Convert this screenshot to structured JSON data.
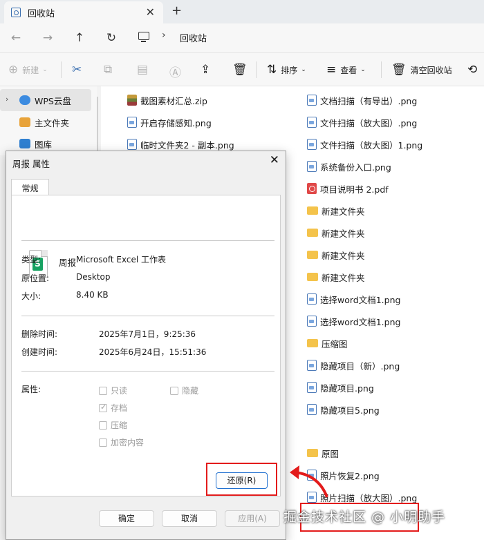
{
  "window": {
    "tab_title": "回收站",
    "tab_close_icon": "close-icon",
    "new_tab_icon": "plus-icon"
  },
  "nav": {
    "back": "←",
    "forward": "→",
    "up": "↑",
    "refresh": "↻",
    "breadcrumb_separator": "›",
    "breadcrumb": "回收站"
  },
  "toolbar": {
    "new_label": "新建",
    "sort_label": "排序",
    "view_label": "查看",
    "empty_bin_label": "清空回收站",
    "icons": [
      "cut-icon",
      "copy-icon",
      "paste-icon",
      "rename-icon",
      "share-icon",
      "delete-icon"
    ]
  },
  "sidebar": {
    "items": [
      {
        "label": "WPS云盘",
        "icon": "cloud-icon",
        "selected": true
      },
      {
        "label": "主文件夹",
        "icon": "home-icon"
      },
      {
        "label": "图库",
        "icon": "gallery-icon"
      }
    ]
  },
  "files": {
    "col1": [
      {
        "name": "截图素材汇总.zip",
        "type": "zip"
      },
      {
        "name": "开启存储感知.png",
        "type": "png"
      },
      {
        "name": "临时文件夹2 - 副本.png",
        "type": "png"
      }
    ],
    "col2": [
      {
        "name": "文档扫描（有导出）.png",
        "type": "png"
      },
      {
        "name": "文件扫描（放大图）.png",
        "type": "png"
      },
      {
        "name": "文件扫描（放大图）1.png",
        "type": "png"
      },
      {
        "name": "系统备份入口.png",
        "type": "png"
      },
      {
        "name": "项目说明书 2.pdf",
        "type": "pdf"
      },
      {
        "name": "新建文件夹",
        "type": "folder"
      },
      {
        "name": "新建文件夹",
        "type": "folder"
      },
      {
        "name": "新建文件夹",
        "type": "folder"
      },
      {
        "name": "新建文件夹",
        "type": "folder"
      },
      {
        "name": "选择word文档1.png",
        "type": "png"
      },
      {
        "name": "选择word文档1.png",
        "type": "png"
      },
      {
        "name": "压缩图",
        "type": "folder"
      },
      {
        "name": "隐藏项目（新）.png",
        "type": "png"
      },
      {
        "name": "隐藏项目.png",
        "type": "png"
      },
      {
        "name": "隐藏项目5.png",
        "type": "png"
      },
      {
        "name": "原图",
        "type": "folder"
      },
      {
        "name": "照片恢复2.png",
        "type": "png"
      },
      {
        "name": "照片扫描（放大图）.png",
        "type": "png"
      }
    ]
  },
  "dialog": {
    "title": "周报 属性",
    "tab": "常规",
    "file_name": "周报",
    "file_icon_letter": "S",
    "type_label": "类型:",
    "type_value": "Microsoft Excel 工作表",
    "location_label": "原位置:",
    "location_value": "Desktop",
    "size_label": "大小:",
    "size_value": "8.40 KB",
    "deleted_label": "删除时间:",
    "deleted_value": "2025年7月1日，9:25:36",
    "created_label": "创建时间:",
    "created_value": "2025年6月24日，15:51:36",
    "attributes_label": "属性:",
    "attributes": {
      "readonly": {
        "label": "只读",
        "checked": false
      },
      "hidden": {
        "label": "隐藏",
        "checked": false
      },
      "archive": {
        "label": "存档",
        "checked": true
      },
      "compress": {
        "label": "压缩",
        "checked": false
      },
      "encrypt": {
        "label": "加密内容",
        "checked": false
      }
    },
    "restore_button": "还原(R)",
    "ok_button": "确定",
    "cancel_button": "取消",
    "apply_button": "应用(A)"
  },
  "annotation": {
    "highlight_color": "#e31b1b"
  },
  "watermark": "掘金技术社区 @ 小明助手"
}
